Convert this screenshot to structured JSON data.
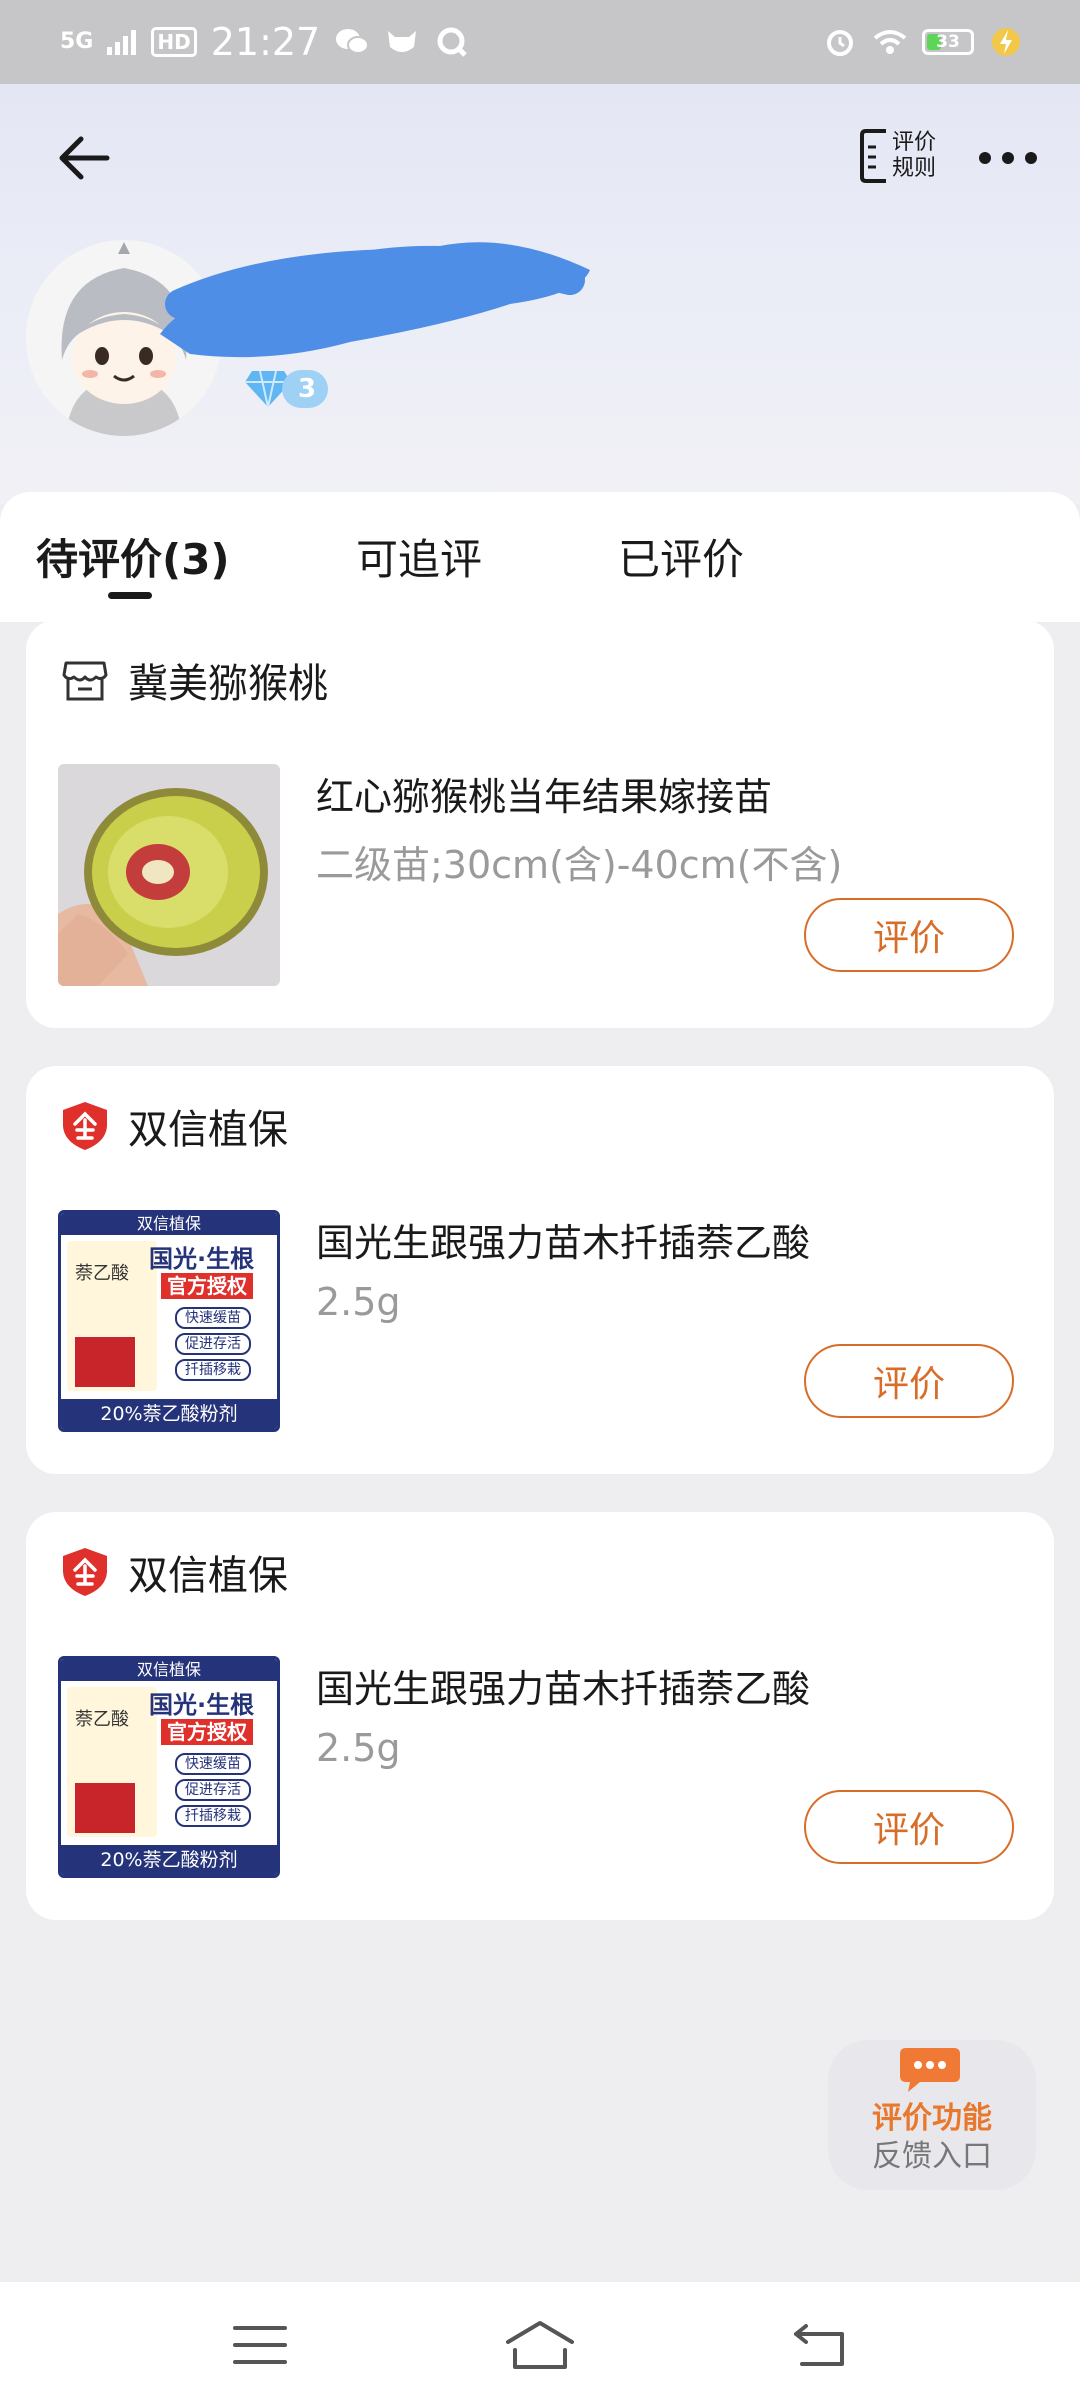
{
  "status_bar": {
    "network": "5G",
    "hd": "HD",
    "time": "21:27",
    "battery_percent": 33,
    "battery_label": "33"
  },
  "header": {
    "rules_label_line1": "评价",
    "rules_label_line2": "规则",
    "level": "3"
  },
  "tabs": [
    {
      "label": "待评价(3)",
      "active": true
    },
    {
      "label": "可追评",
      "active": false
    },
    {
      "label": "已评价",
      "active": false
    }
  ],
  "orders": [
    {
      "shop": "冀美猕猴桃",
      "shop_icon": "store-icon",
      "title": "红心猕猴桃当年结果嫁接苗",
      "spec": "二级苗;30cm(含)-40cm(不含)",
      "button": "评价"
    },
    {
      "shop": "双信植保",
      "shop_icon": "enterprise-shield-icon",
      "title": "国光生跟强力苗木扦插萘乙酸",
      "spec": "2.5g",
      "button": "评价",
      "product_image": {
        "brand": "双信植保",
        "headline": "国光·生根",
        "tag": "官方授权",
        "features": [
          "快速缓苗",
          "促进存活",
          "扦插移栽"
        ],
        "bottom": "20%萘乙酸粉剂",
        "pack_name": "萘乙酸"
      }
    },
    {
      "shop": "双信植保",
      "shop_icon": "enterprise-shield-icon",
      "title": "国光生跟强力苗木扦插萘乙酸",
      "spec": "2.5g",
      "button": "评价",
      "product_image": {
        "brand": "双信植保",
        "headline": "国光·生根",
        "tag": "官方授权",
        "features": [
          "快速缓苗",
          "促进存活",
          "扦插移栽"
        ],
        "bottom": "20%萘乙酸粉剂",
        "pack_name": "萘乙酸"
      }
    }
  ],
  "feedback": {
    "line1": "评价功能",
    "line2": "反馈入口"
  },
  "colors": {
    "accent": "#d86d2a",
    "shield_red": "#e0302c",
    "product_blue": "#25337a"
  }
}
